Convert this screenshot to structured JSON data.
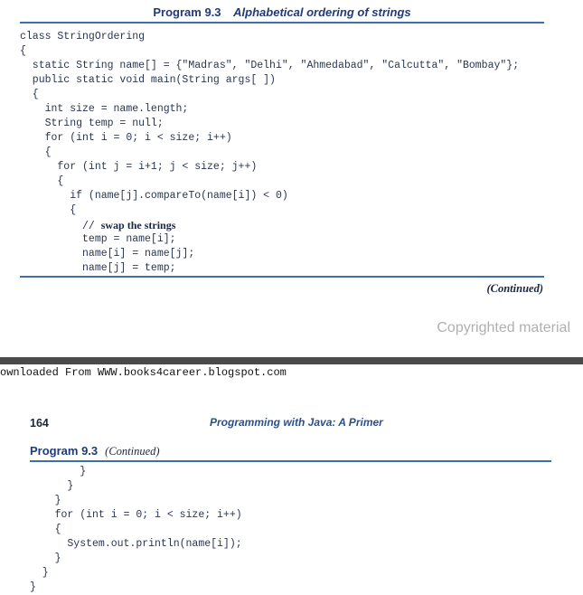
{
  "page1": {
    "program_number": "Program 9.3",
    "program_title": "Alphabetical ordering of strings",
    "code_lines": [
      "class StringOrdering",
      "{",
      "  static String name[] = {\"Madras\", \"Delhi\", \"Ahmedabad\", \"Calcutta\", \"Bombay\"};",
      "  public static void main(String args[ ])",
      "  {",
      "    int size = name.length;",
      "    String temp = null;",
      "    for (int i = 0; i < size; i++)",
      "    {",
      "      for (int j = i+1; j < size; j++)",
      "      {",
      "        if (name[j].compareTo(name[i]) < 0)",
      "        {",
      "          temp = name[i];",
      "          name[i] = name[j];",
      "          name[j] = temp;"
    ],
    "comment_prefix": "          // ",
    "comment_text": "swap the strings",
    "continued": "(Continued)",
    "copyright": "Copyrighted material"
  },
  "page2": {
    "download_line": "ownloaded From WWW.books4career.blogspot.com",
    "page_number": "164",
    "book_title": "Programming with Java: A Primer",
    "program_number": "Program 9.3",
    "continued": "(Continued)",
    "code_lines": [
      "        }",
      "      }",
      "    }",
      "    for (int i = 0; i < size; i++)",
      "    {",
      "      System.out.println(name[i]);",
      "    }",
      "  }",
      "}"
    ]
  }
}
